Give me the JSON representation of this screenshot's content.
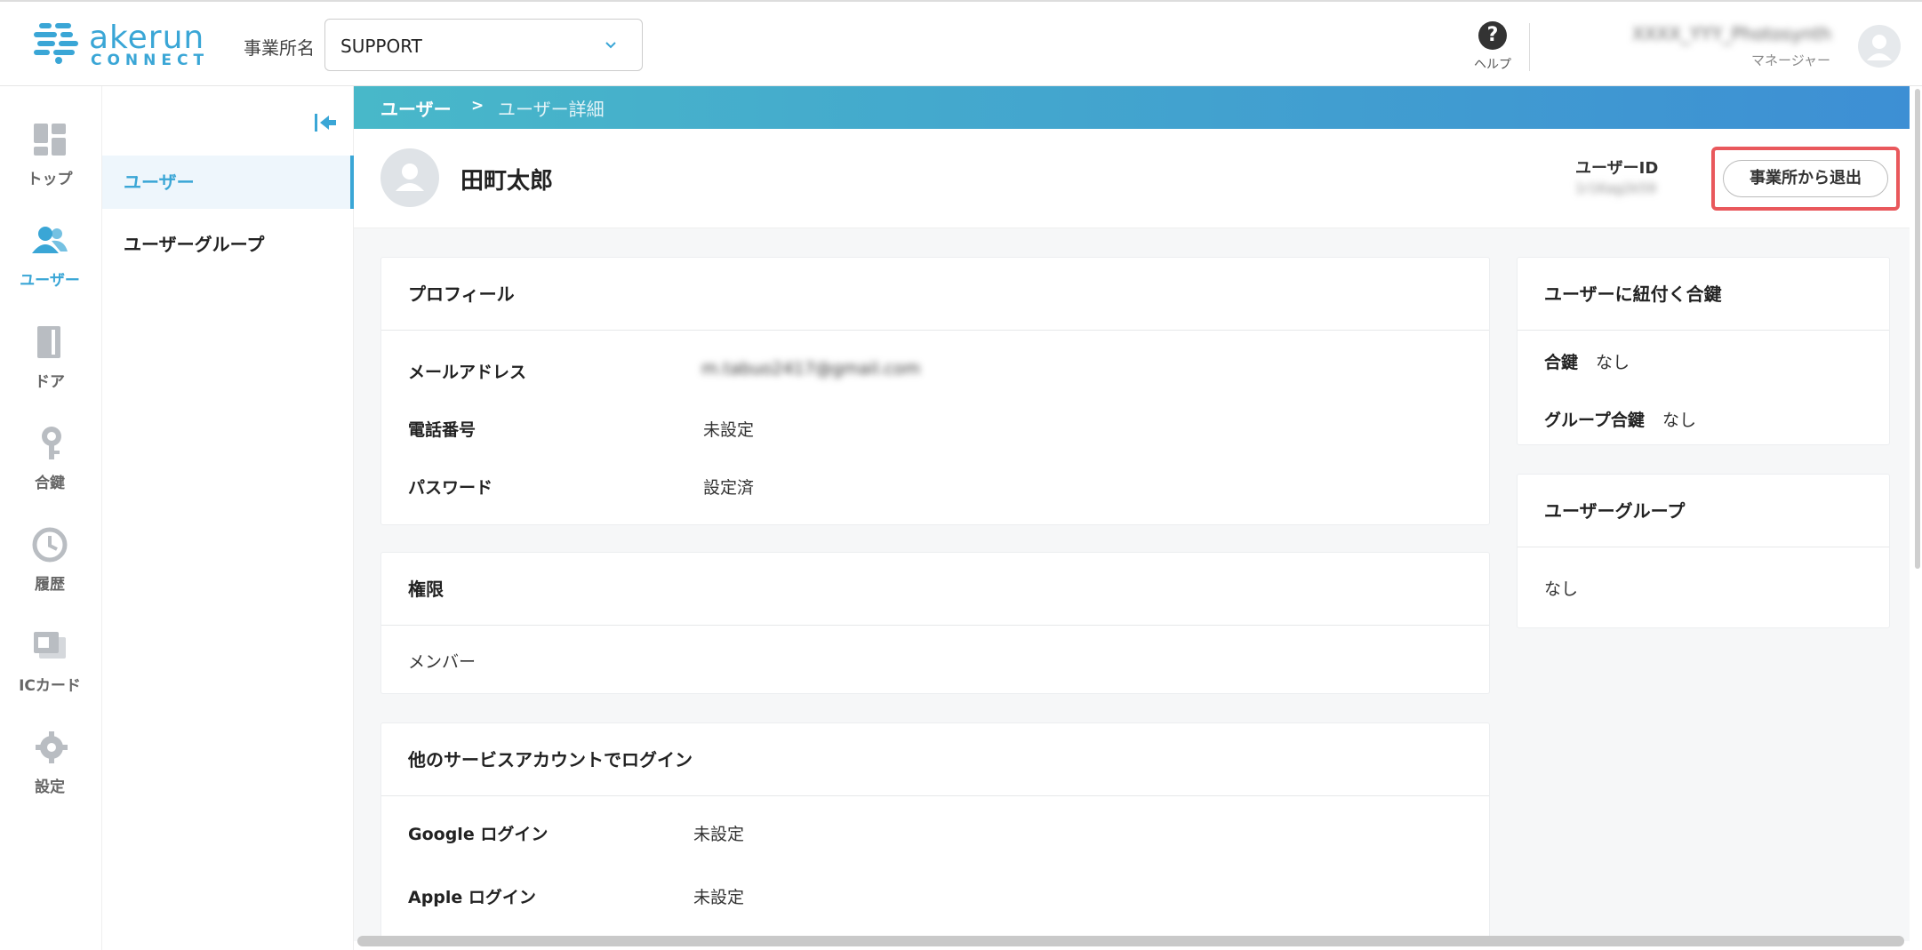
{
  "brand": {
    "name": "akerun",
    "sub": "CONNECT"
  },
  "header": {
    "office_label": "事業所名",
    "office_value": "SUPPORT",
    "help_label": "ヘルプ",
    "user_name": "XXXX_YYY_Photosynth",
    "user_role": "マネージャー"
  },
  "nav": {
    "items": [
      {
        "label": "トップ",
        "icon": "dashboard-icon"
      },
      {
        "label": "ユーザー",
        "icon": "users-icon"
      },
      {
        "label": "ドア",
        "icon": "door-icon"
      },
      {
        "label": "合鍵",
        "icon": "key-icon"
      },
      {
        "label": "履歴",
        "icon": "history-icon"
      },
      {
        "label": "ICカード",
        "icon": "ic-card-icon"
      },
      {
        "label": "設定",
        "icon": "gear-icon"
      }
    ]
  },
  "subnav": {
    "items": [
      {
        "label": "ユーザー"
      },
      {
        "label": "ユーザーグループ"
      }
    ]
  },
  "breadcrumb": {
    "root": "ユーザー",
    "sep": ">",
    "current": "ユーザー詳細"
  },
  "user": {
    "name": "田町太郎",
    "id_label": "ユーザーID",
    "id_value": "1r1Kag2k59",
    "leave_button": "事業所から退出"
  },
  "profile": {
    "title": "プロフィール",
    "rows": [
      {
        "label": "メールアドレス",
        "value": "m.tabuo2417@gmail.com"
      },
      {
        "label": "電話番号",
        "value": "未設定"
      },
      {
        "label": "パスワード",
        "value": "設定済"
      }
    ]
  },
  "permission": {
    "title": "権限",
    "value": "メンバー"
  },
  "social": {
    "title": "他のサービスアカウントでログイン",
    "rows": [
      {
        "label": "Google ログイン",
        "value": "未設定"
      },
      {
        "label": "Apple ログイン",
        "value": "未設定"
      }
    ]
  },
  "keys": {
    "title": "ユーザーに紐付く合鍵",
    "rows": [
      {
        "label": "合鍵",
        "value": "なし"
      },
      {
        "label": "グループ合鍵",
        "value": "なし"
      }
    ]
  },
  "groups": {
    "title": "ユーザーグループ",
    "value": "なし"
  }
}
